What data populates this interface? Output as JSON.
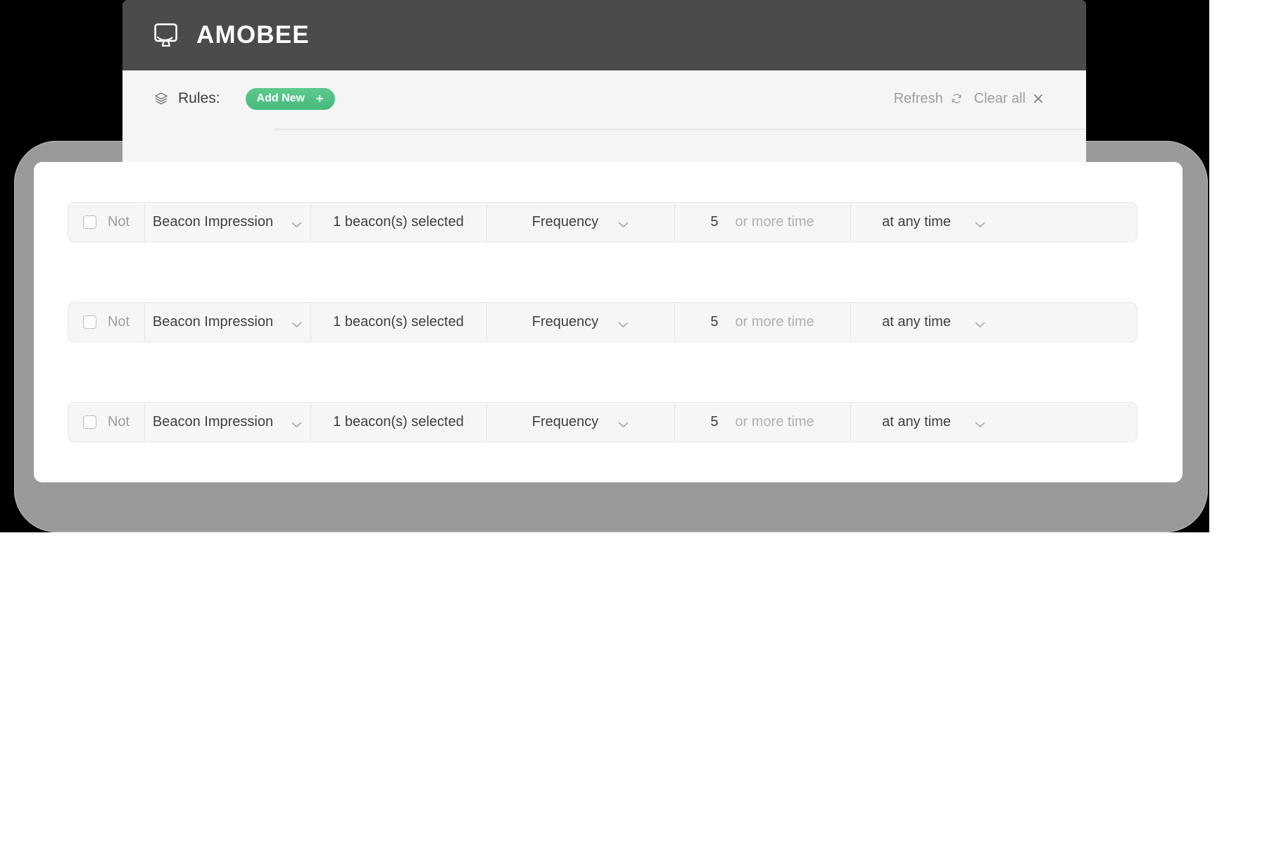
{
  "app": {
    "brand_name": "AMOBEE",
    "logo_icon": "monitor-icon",
    "header_bg": "#4b4b4b",
    "accent_color": "#4ebb83"
  },
  "toolbar": {
    "rules_icon": "layers-icon",
    "rules_label": "Rules:",
    "add_new_label": "Add New",
    "add_new_plus": "+",
    "refresh_label": "Refresh",
    "refresh_icon": "refresh-icon",
    "clear_all_label": "Clear all",
    "clear_all_icon": "close-icon"
  },
  "rules": [
    {
      "not_label": "Not",
      "not_checked": false,
      "type_value": "Beacon Impression",
      "beacons_value": "1 beacon(s) selected",
      "metric_value": "Frequency",
      "count_value": "5",
      "count_placeholder": "or more time",
      "window_value": "at any time"
    },
    {
      "not_label": "Not",
      "not_checked": false,
      "type_value": "Beacon Impression",
      "beacons_value": "1 beacon(s) selected",
      "metric_value": "Frequency",
      "count_value": "5",
      "count_placeholder": "or more time",
      "window_value": "at any time"
    },
    {
      "not_label": "Not",
      "not_checked": false,
      "type_value": "Beacon Impression",
      "beacons_value": "1 beacon(s) selected",
      "metric_value": "Frequency",
      "count_value": "5",
      "count_placeholder": "or more time",
      "window_value": "at any time"
    }
  ]
}
